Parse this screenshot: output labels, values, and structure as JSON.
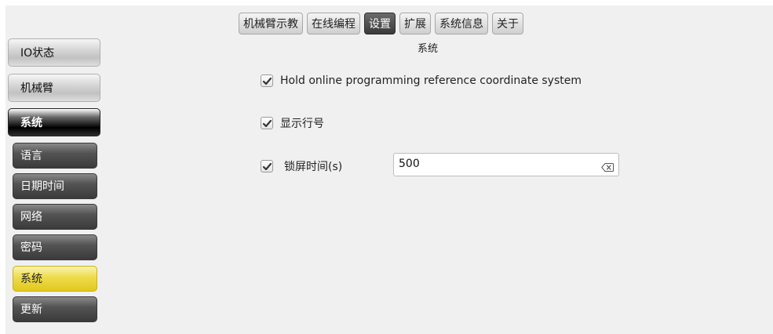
{
  "top_tabs": [
    {
      "label": "机械臂示教"
    },
    {
      "label": "在线编程"
    },
    {
      "label": "设置"
    },
    {
      "label": "扩展"
    },
    {
      "label": "系统信息"
    },
    {
      "label": "关于"
    }
  ],
  "active_tab": "设置",
  "section_title": "系统",
  "sidebar": {
    "main_items": [
      {
        "label": "IO状态"
      },
      {
        "label": "机械臂"
      },
      {
        "label": "系统"
      }
    ],
    "sub_items": [
      {
        "label": "语言"
      },
      {
        "label": "日期时间"
      },
      {
        "label": "网络"
      },
      {
        "label": "密码"
      },
      {
        "label": "系统"
      },
      {
        "label": "更新"
      }
    ],
    "selected_sub": "系统"
  },
  "options": {
    "hold_reference": {
      "label": "Hold online programming reference coordinate system",
      "checked": true
    },
    "show_line_numbers": {
      "label": "显示行号",
      "checked": true
    },
    "lock_screen": {
      "label": "锁屏时间(s)",
      "checked": true,
      "value": "500"
    }
  },
  "icons": {
    "checkmark": "check-icon",
    "clear": "clear-input-icon"
  },
  "colors": {
    "selected_yellow": "#eedb4a",
    "active_tab_dark": "#3a3a3a",
    "background": "#f0f0f0"
  }
}
